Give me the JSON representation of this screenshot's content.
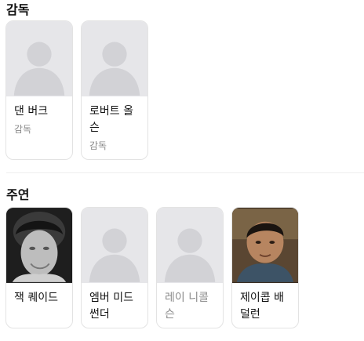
{
  "sections": {
    "director": {
      "title": "감독",
      "people": [
        {
          "name": "댄 버크",
          "role": "감독",
          "photo": "placeholder"
        },
        {
          "name": "로버트 올슨",
          "role": "감독",
          "photo": "placeholder"
        }
      ]
    },
    "cast": {
      "title": "주연",
      "people": [
        {
          "name": "잭 퀘이드",
          "photo": "portrait-bw"
        },
        {
          "name": "엠버 미드썬더",
          "photo": "placeholder"
        },
        {
          "name": "레이 니콜슨",
          "photo": "placeholder",
          "muted": true
        },
        {
          "name": "제이콥 배덜런",
          "photo": "portrait-color"
        }
      ]
    }
  },
  "colors": {
    "placeholder_bg": "#e6e6e9",
    "placeholder_silhouette": "#d2d2d6",
    "card_border": "#e3e3e3",
    "muted_text": "#8a8a8a"
  },
  "icons": {
    "placeholder": "person-silhouette-icon"
  }
}
